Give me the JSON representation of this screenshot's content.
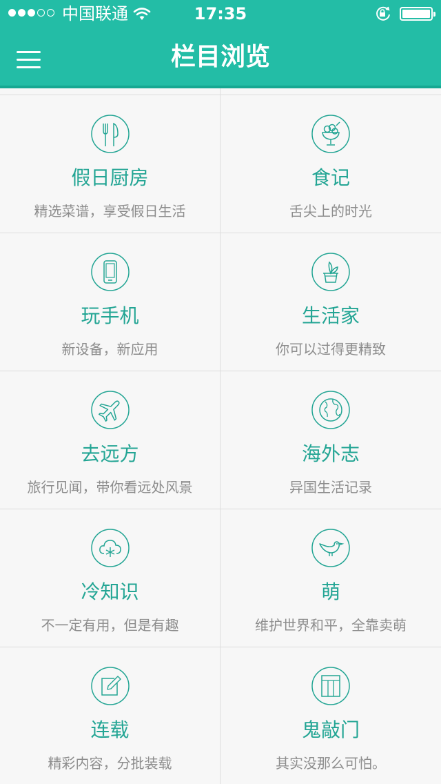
{
  "status_bar": {
    "carrier": "中国联通",
    "time": "17:35",
    "signal_strength": 3,
    "battery_level": 1.0
  },
  "nav": {
    "title": "栏目浏览",
    "menu_icon": "hamburger-menu-icon"
  },
  "theme": {
    "accent": "#23bda6",
    "title_color": "#23a594",
    "subtitle_color": "#8d8d8d"
  },
  "categories": [
    {
      "title": "假日厨房",
      "subtitle": "精选菜谱，享受假日生活",
      "icon": "fork-knife-icon"
    },
    {
      "title": "食记",
      "subtitle": "舌尖上的时光",
      "icon": "ice-cream-icon"
    },
    {
      "title": "玩手机",
      "subtitle": "新设备，新应用",
      "icon": "phone-icon"
    },
    {
      "title": "生活家",
      "subtitle": "你可以过得更精致",
      "icon": "plant-pot-icon"
    },
    {
      "title": "去远方",
      "subtitle": "旅行见闻，带你看远处风景",
      "icon": "airplane-icon"
    },
    {
      "title": "海外志",
      "subtitle": "异国生活记录",
      "icon": "globe-icon"
    },
    {
      "title": "冷知识",
      "subtitle": "不一定有用，但是有趣",
      "icon": "snow-cloud-icon"
    },
    {
      "title": "萌",
      "subtitle": "维护世界和平，全靠卖萌",
      "icon": "bird-icon"
    },
    {
      "title": "连载",
      "subtitle": "精彩内容，分批装载",
      "icon": "edit-note-icon"
    },
    {
      "title": "鬼敲门",
      "subtitle": "其实没那么可怕。",
      "icon": "door-icon"
    }
  ]
}
